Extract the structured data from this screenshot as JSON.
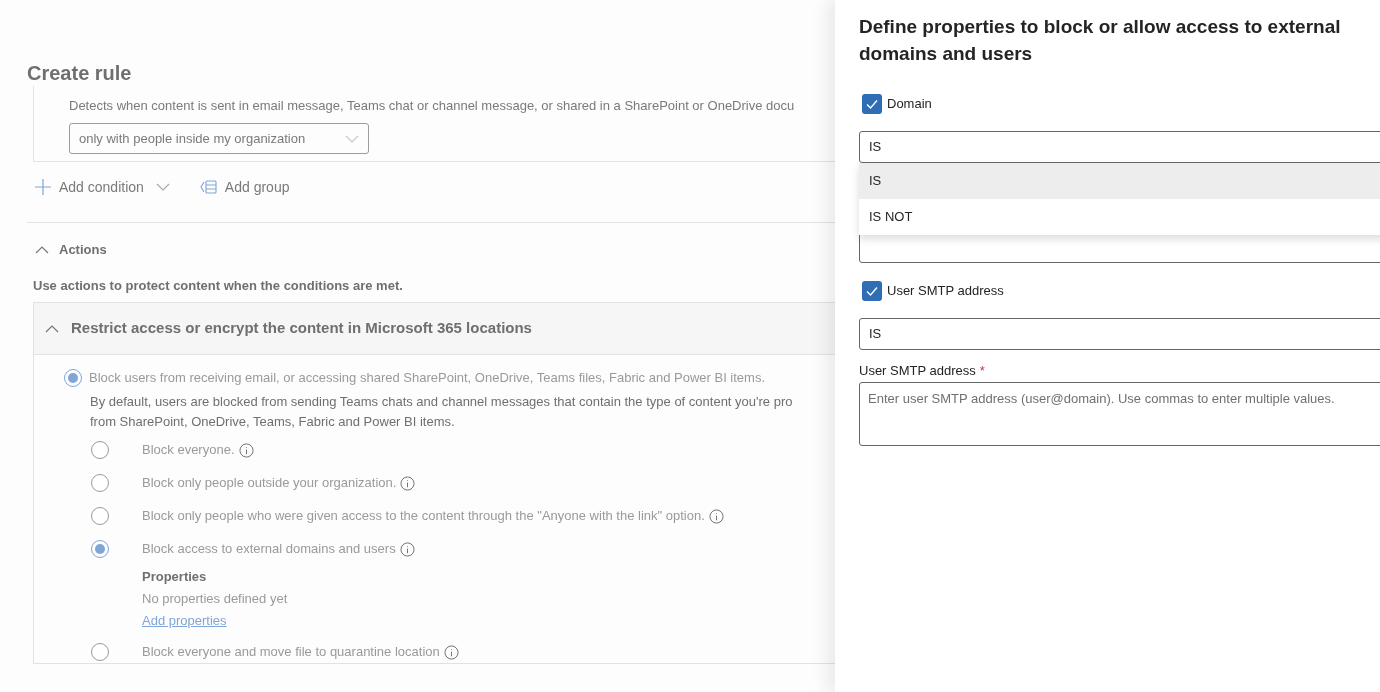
{
  "page": {
    "title": "Create rule",
    "condition_description": "Detects when content is sent in email message, Teams chat or channel message, or shared in a SharePoint or OneDrive docu",
    "condition_dropdown": {
      "value": "only with people inside my organization"
    },
    "add_condition": "Add condition",
    "add_group": "Add group"
  },
  "actions": {
    "heading": "Actions",
    "expanded": true,
    "description": "Use actions to protect content when the conditions are met.",
    "section": {
      "title": "Restrict access or encrypt the content in Microsoft 365 locations",
      "expanded": true,
      "main_option": {
        "label": "Block users from receiving email, or accessing shared SharePoint, OneDrive, Teams files, Fabric and Power BI items.",
        "selected": true,
        "description_lines": [
          "By default, users are blocked from sending Teams chats and channel messages that contain the type of content you're pro",
          "from SharePoint, OneDrive, Teams, Fabric and Power BI items."
        ]
      },
      "options": [
        {
          "label": "Block everyone.",
          "selected": false
        },
        {
          "label": "Block only people outside your organization.",
          "selected": false
        },
        {
          "label": "Block only people who were given access to the content through the \"Anyone with the link\" option.",
          "selected": false
        },
        {
          "label": "Block access to external domains and users",
          "selected": true,
          "properties": {
            "heading": "Properties",
            "empty_text": "No properties defined yet",
            "link": "Add properties"
          }
        },
        {
          "label": "Block everyone and move file to quarantine location",
          "selected": false
        }
      ]
    }
  },
  "panel": {
    "title": "Define properties to block or allow access to external domains and users",
    "domain": {
      "label": "Domain",
      "checked": true,
      "operator": {
        "value": "IS"
      },
      "menu": [
        {
          "label": "IS",
          "selected": true
        },
        {
          "label": "IS NOT",
          "selected": false
        }
      ]
    },
    "smtp": {
      "label": "User SMTP address",
      "checked": true,
      "operator": {
        "value": "IS"
      },
      "field_label": "User SMTP address",
      "required_mark": "*",
      "placeholder": "Enter user SMTP address (user@domain). Use commas to enter multiple values."
    }
  }
}
